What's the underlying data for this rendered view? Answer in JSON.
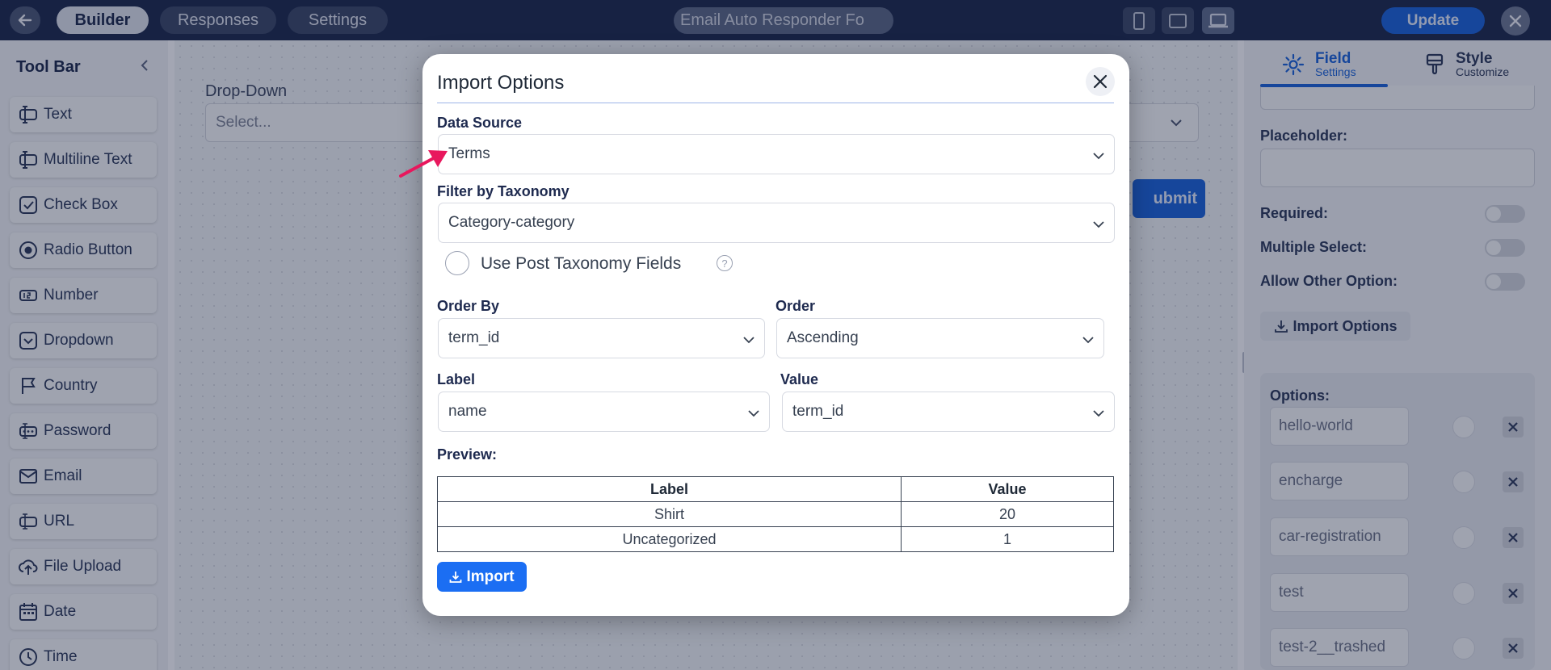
{
  "topbar": {
    "tabs": [
      "Builder",
      "Responses",
      "Settings"
    ],
    "form_title": "Email Auto Responder Fo",
    "update_label": "Update"
  },
  "toolbar": {
    "title": "Tool Bar",
    "items": [
      {
        "label": "Text",
        "icon": "text-field-icon"
      },
      {
        "label": "Multiline Text",
        "icon": "multiline-text-icon"
      },
      {
        "label": "Check Box",
        "icon": "checkbox-icon"
      },
      {
        "label": "Radio Button",
        "icon": "radio-icon"
      },
      {
        "label": "Number",
        "icon": "number-icon"
      },
      {
        "label": "Dropdown",
        "icon": "dropdown-icon"
      },
      {
        "label": "Country",
        "icon": "flag-icon"
      },
      {
        "label": "Password",
        "icon": "password-icon"
      },
      {
        "label": "Email",
        "icon": "email-icon"
      },
      {
        "label": "URL",
        "icon": "url-icon"
      },
      {
        "label": "File Upload",
        "icon": "upload-icon"
      },
      {
        "label": "Date",
        "icon": "calendar-icon"
      },
      {
        "label": "Time",
        "icon": "clock-icon"
      }
    ]
  },
  "canvas": {
    "field_label": "Drop-Down",
    "field_placeholder": "Select...",
    "submit_label": "ubmit"
  },
  "right_panel": {
    "tabs": [
      {
        "main": "Field",
        "sub": "Settings"
      },
      {
        "main": "Style",
        "sub": "Customize"
      }
    ],
    "placeholder_label": "Placeholder:",
    "required_label": "Required:",
    "multiple_select_label": "Multiple Select:",
    "allow_other_label": "Allow Other Option:",
    "import_options_label": "Import Options",
    "options_title": "Options:",
    "options": [
      "hello-world",
      "encharge",
      "car-registration",
      "test",
      "test-2__trashed"
    ]
  },
  "modal": {
    "title": "Import Options",
    "data_source_label": "Data Source",
    "data_source_value": "Terms",
    "filter_label": "Filter by Taxonomy",
    "filter_value": "Category-category",
    "use_post_taxonomy_label": "Use Post Taxonomy Fields",
    "order_by_label": "Order By",
    "order_by_value": "term_id",
    "order_label": "Order",
    "order_value": "Ascending",
    "label_label": "Label",
    "label_value": "name",
    "value_label": "Value",
    "value_value": "term_id",
    "preview_label": "Preview:",
    "preview_headers": [
      "Label",
      "Value"
    ],
    "preview_rows": [
      [
        "Shirt",
        "20"
      ],
      [
        "Uncategorized",
        "1"
      ]
    ],
    "import_label": "Import"
  },
  "colors": {
    "accent": "#1b6ef3",
    "topbar": "#1e2a4f",
    "annotation_arrow": "#e8175d"
  }
}
